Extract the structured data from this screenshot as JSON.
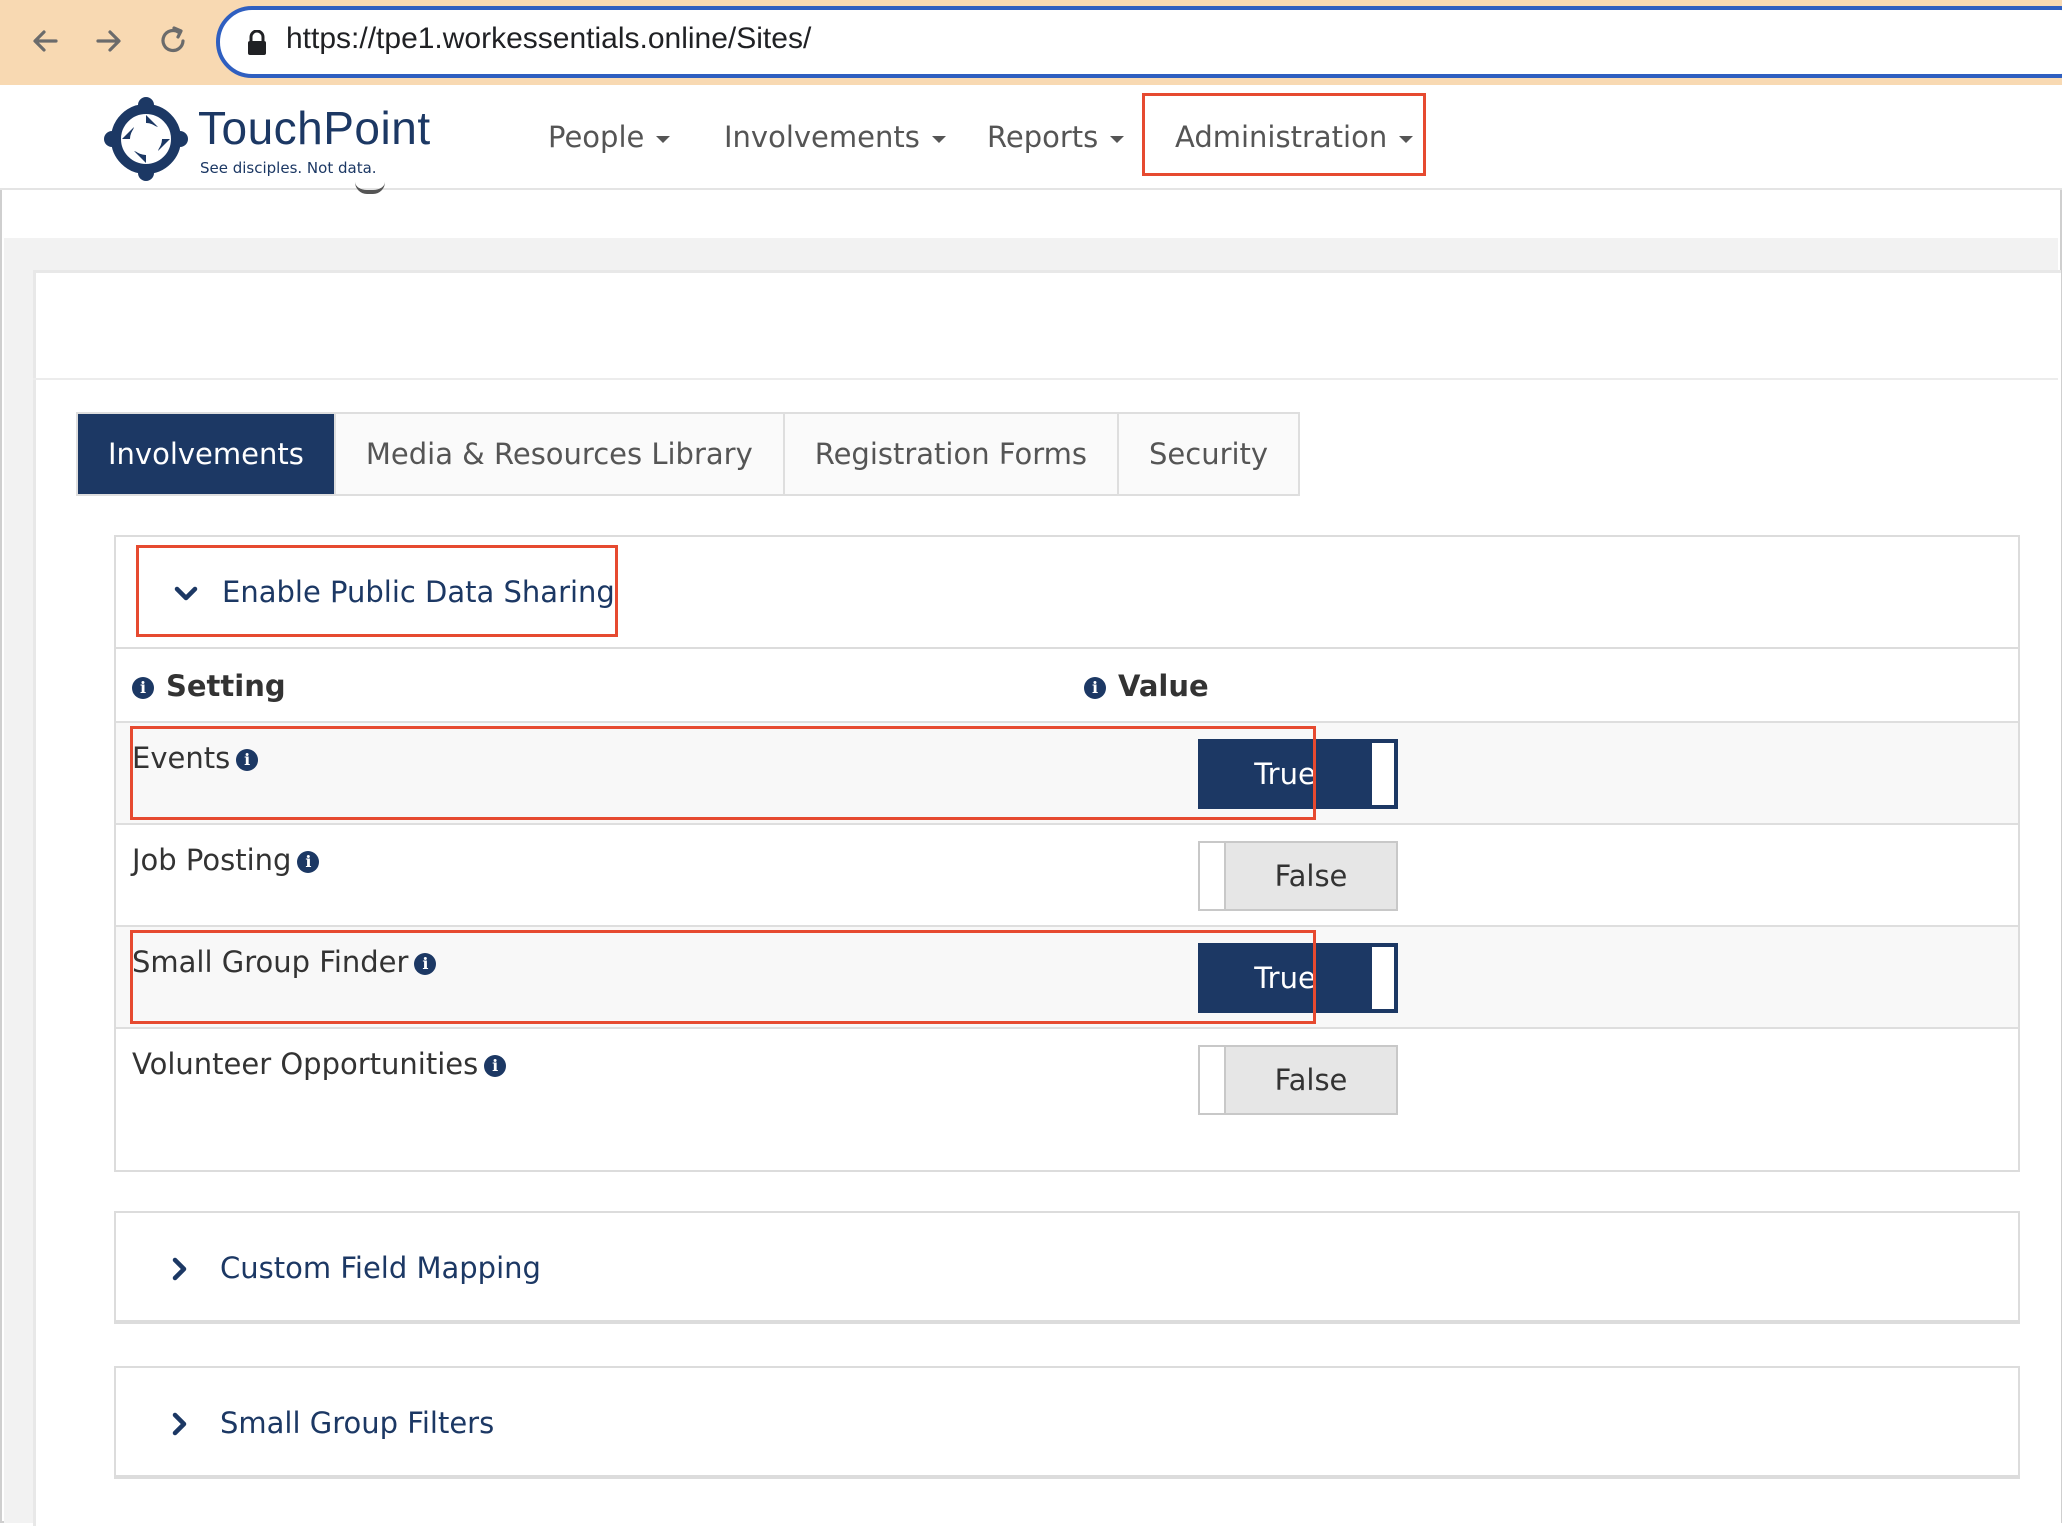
{
  "browser": {
    "url": "https://tpe1.workessentials.online/Sites/",
    "icons": [
      "back-icon",
      "forward-icon",
      "reload-icon",
      "lock-icon"
    ]
  },
  "brand": {
    "name": "TouchPoint",
    "tagline": "See disciples. Not data.",
    "color": "#1c3864"
  },
  "nav": {
    "items": [
      {
        "label": "People"
      },
      {
        "label": "Involvements"
      },
      {
        "label": "Reports"
      },
      {
        "label": "Administration"
      }
    ]
  },
  "tabs": [
    {
      "label": "Involvements",
      "active": true
    },
    {
      "label": "Media & Resources Library",
      "active": false
    },
    {
      "label": "Registration Forms",
      "active": false
    },
    {
      "label": "Security",
      "active": false
    }
  ],
  "sharing": {
    "title": "Enable Public Data Sharing",
    "col_setting": "Setting",
    "col_value": "Value",
    "rows": [
      {
        "label": "Events",
        "value": "True"
      },
      {
        "label": "Job Posting",
        "value": "False"
      },
      {
        "label": "Small Group Finder",
        "value": "True"
      },
      {
        "label": "Volunteer Opportunities",
        "value": "False"
      }
    ]
  },
  "panels": {
    "custom_field_mapping": "Custom Field Mapping",
    "small_group_filters": "Small Group Filters"
  },
  "colors": {
    "accent": "#1c3864",
    "highlight": "#e64a30",
    "browser_bar": "#f8d9b2"
  }
}
